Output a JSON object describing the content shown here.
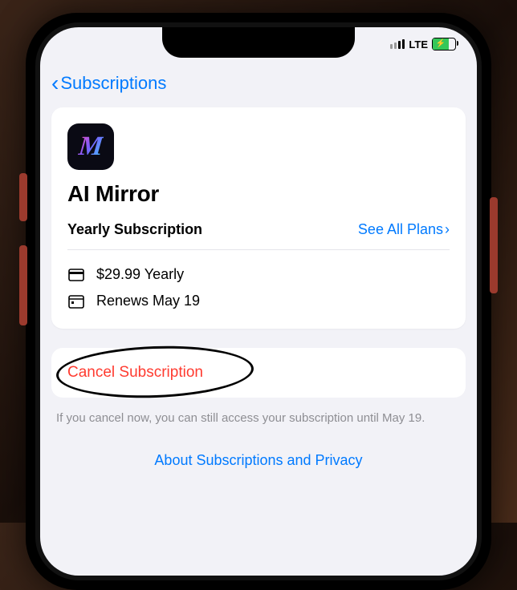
{
  "status": {
    "network": "LTE"
  },
  "nav": {
    "back_label": "Subscriptions"
  },
  "app": {
    "icon_letter": "M",
    "name": "AI Mirror",
    "plan_type": "Yearly Subscription",
    "see_all_label": "See All Plans",
    "price_line": "$29.99 Yearly",
    "renew_line": "Renews May 19"
  },
  "cancel": {
    "button_label": "Cancel Subscription",
    "note": "If you cancel now, you can still access your subscription until May 19."
  },
  "footer": {
    "link": "About Subscriptions and Privacy"
  }
}
